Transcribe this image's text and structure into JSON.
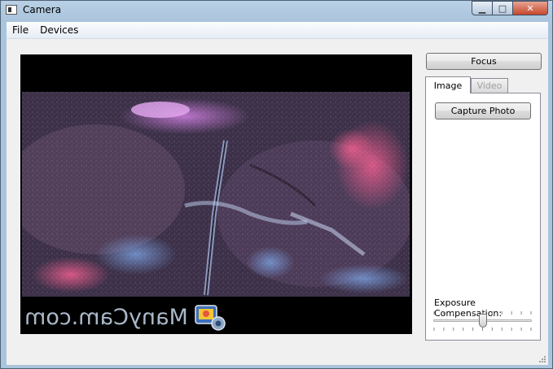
{
  "window": {
    "title": "Camera"
  },
  "menu": {
    "items": [
      "File",
      "Devices"
    ]
  },
  "controls": {
    "focus_label": "Focus",
    "tabs": [
      "Image",
      "Video"
    ],
    "active_tab": "Image",
    "capture_label": "Capture Photo",
    "exposure_label": "Exposure Compensation:",
    "exposure_value_fraction": 0.5
  },
  "viewfinder": {
    "watermark": "ManyCam.com"
  },
  "colors": {
    "titlebar": "#b9d1e6",
    "close_button": "#c7452c",
    "viewfinder_bg": "#000000",
    "scene_tone": "#4a3a52"
  },
  "icons": [
    "camera-app-icon",
    "minimize-icon",
    "maximize-icon",
    "close-icon",
    "manycam-logo",
    "resize-grip-icon"
  ]
}
